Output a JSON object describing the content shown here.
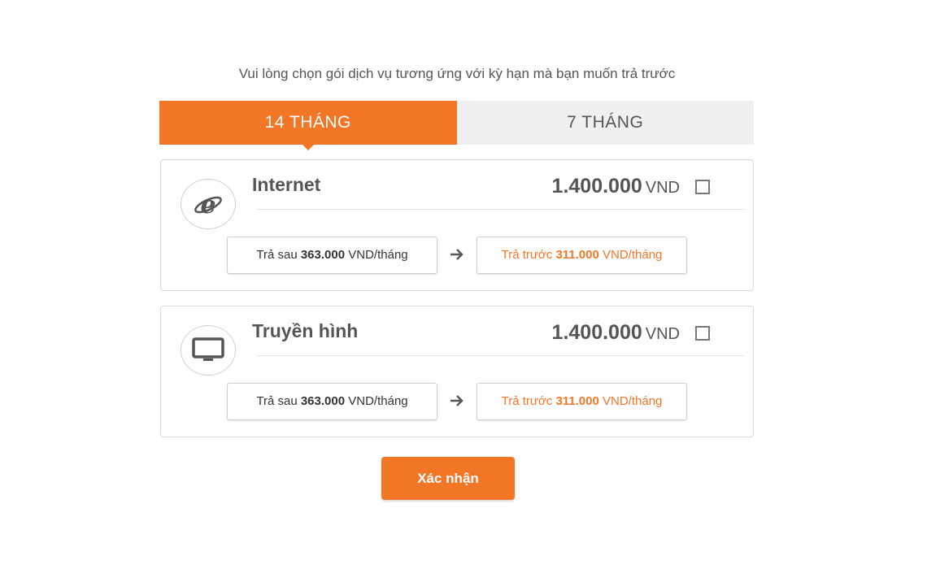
{
  "instruction": "Vui lòng chọn gói dịch vụ tương ứng với kỳ hạn mà bạn muốn trả trước",
  "tabs": [
    {
      "label": "14 THÁNG",
      "active": true
    },
    {
      "label": "7 THÁNG",
      "active": false
    }
  ],
  "services": [
    {
      "name": "Internet",
      "icon": "internet-explorer-icon",
      "price_amount": "1.400.000",
      "price_currency": "VND",
      "checked": false,
      "pay_after": {
        "prefix": "Trả sau",
        "amount": "363.000",
        "suffix": "VND/tháng"
      },
      "pay_before": {
        "prefix": "Trả trước",
        "amount": "311.000",
        "suffix": "VND/tháng"
      }
    },
    {
      "name": "Truyền hình",
      "icon": "tv-monitor-icon",
      "price_amount": "1.400.000",
      "price_currency": "VND",
      "checked": false,
      "pay_after": {
        "prefix": "Trả sau",
        "amount": "363.000",
        "suffix": "VND/tháng"
      },
      "pay_before": {
        "prefix": "Trả trước",
        "amount": "311.000",
        "suffix": "VND/tháng"
      }
    }
  ],
  "confirm_label": "Xác nhận",
  "colors": {
    "accent": "#f37627",
    "text": "#555555",
    "tab_inactive_bg": "#f0f0f0"
  }
}
